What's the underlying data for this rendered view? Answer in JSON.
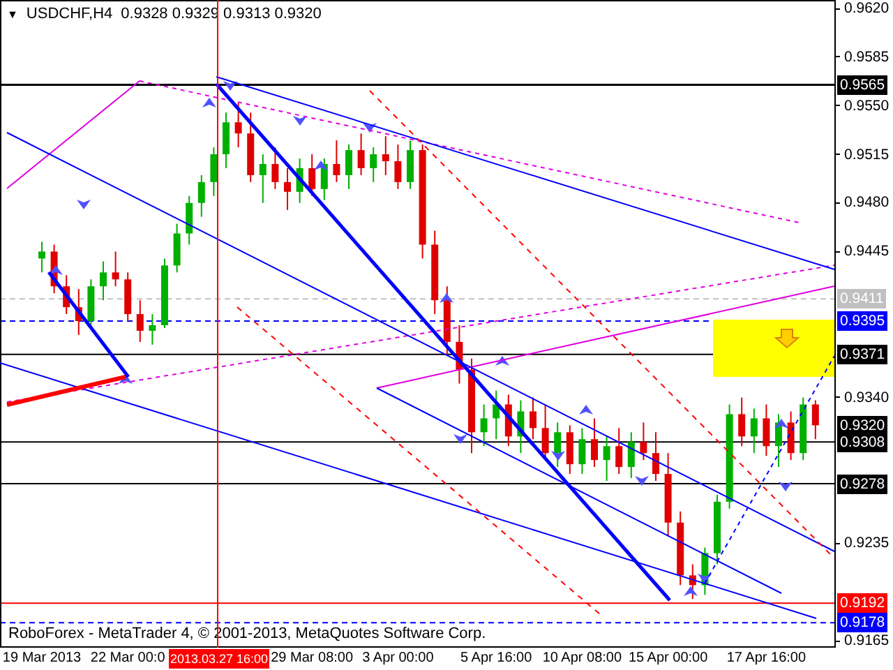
{
  "chart": {
    "symbol_menu": "▼",
    "title": "USDCHF,H4",
    "ohlc": "0.9328 0.9329 0.9313 0.9320",
    "copyright": "RoboForex - MetaTrader 4, © 2001-2013, MetaQuotes Software Corp.",
    "bid_marker": "0.9320",
    "crosshair_label": "2013.03.27 16:00",
    "chart_data": {
      "type": "candlestick",
      "categories": [
        "19 Mar 2013",
        null,
        null,
        null,
        null,
        null,
        null,
        "22 Mar 00:0",
        null,
        null,
        null,
        null,
        null,
        null,
        null,
        null,
        null,
        null,
        null,
        null,
        null,
        null,
        "29 Mar 08:00",
        null,
        null,
        null,
        null,
        null,
        null,
        "3 Apr 00:00",
        null,
        null,
        null,
        null,
        null,
        null,
        null,
        "5 Apr 16:00",
        null,
        null,
        null,
        null,
        null,
        null,
        "10 Apr 08:00",
        null,
        null,
        null,
        null,
        null,
        null,
        "15 Apr 00:00",
        null,
        null,
        null,
        null,
        null,
        null,
        null,
        "17 Apr 16:00",
        null,
        null,
        null,
        null
      ],
      "ohlc": [
        [
          0.944,
          0.9452,
          0.943,
          0.9445
        ],
        [
          0.9445,
          0.945,
          0.9415,
          0.942
        ],
        [
          0.942,
          0.9428,
          0.94,
          0.9405
        ],
        [
          0.9405,
          0.9418,
          0.9385,
          0.9395
        ],
        [
          0.9395,
          0.9425,
          0.939,
          0.942
        ],
        [
          0.942,
          0.9438,
          0.941,
          0.943
        ],
        [
          0.943,
          0.9445,
          0.942,
          0.9425
        ],
        [
          0.9425,
          0.943,
          0.9395,
          0.94
        ],
        [
          0.94,
          0.941,
          0.938,
          0.9388
        ],
        [
          0.9388,
          0.94,
          0.9378,
          0.9392
        ],
        [
          0.9392,
          0.944,
          0.939,
          0.9435
        ],
        [
          0.9435,
          0.9465,
          0.943,
          0.9458
        ],
        [
          0.9458,
          0.9485,
          0.945,
          0.948
        ],
        [
          0.948,
          0.95,
          0.947,
          0.9495
        ],
        [
          0.9495,
          0.952,
          0.9485,
          0.9515
        ],
        [
          0.9515,
          0.9545,
          0.9505,
          0.9538
        ],
        [
          0.9538,
          0.9552,
          0.952,
          0.953
        ],
        [
          0.953,
          0.9545,
          0.9495,
          0.95
        ],
        [
          0.95,
          0.9515,
          0.948,
          0.9508
        ],
        [
          0.9508,
          0.952,
          0.949,
          0.9495
        ],
        [
          0.9495,
          0.9505,
          0.9475,
          0.9488
        ],
        [
          0.9488,
          0.9512,
          0.948,
          0.9505
        ],
        [
          0.9505,
          0.9515,
          0.9485,
          0.949
        ],
        [
          0.949,
          0.9512,
          0.9482,
          0.9508
        ],
        [
          0.9508,
          0.9525,
          0.9495,
          0.95
        ],
        [
          0.95,
          0.9522,
          0.949,
          0.9518
        ],
        [
          0.9518,
          0.953,
          0.95,
          0.9505
        ],
        [
          0.9505,
          0.952,
          0.9495,
          0.9515
        ],
        [
          0.9515,
          0.9528,
          0.95,
          0.951
        ],
        [
          0.951,
          0.9522,
          0.949,
          0.9495
        ],
        [
          0.9495,
          0.9525,
          0.949,
          0.9518
        ],
        [
          0.9518,
          0.9522,
          0.944,
          0.945
        ],
        [
          0.945,
          0.946,
          0.94,
          0.941
        ],
        [
          0.941,
          0.942,
          0.937,
          0.938
        ],
        [
          0.938,
          0.9392,
          0.935,
          0.936
        ],
        [
          0.936,
          0.9368,
          0.93,
          0.9315
        ],
        [
          0.9315,
          0.9335,
          0.9305,
          0.9325
        ],
        [
          0.9325,
          0.9345,
          0.931,
          0.9335
        ],
        [
          0.9335,
          0.9342,
          0.9305,
          0.9312
        ],
        [
          0.9312,
          0.9338,
          0.93,
          0.933
        ],
        [
          0.933,
          0.934,
          0.931,
          0.9318
        ],
        [
          0.9318,
          0.9335,
          0.9295,
          0.93
        ],
        [
          0.93,
          0.9322,
          0.929,
          0.9315
        ],
        [
          0.9315,
          0.932,
          0.9285,
          0.9292
        ],
        [
          0.9292,
          0.9318,
          0.9285,
          0.931
        ],
        [
          0.931,
          0.9325,
          0.929,
          0.9295
        ],
        [
          0.9295,
          0.9312,
          0.928,
          0.9305
        ],
        [
          0.9305,
          0.9318,
          0.9285,
          0.929
        ],
        [
          0.929,
          0.9315,
          0.9282,
          0.9308
        ],
        [
          0.9308,
          0.9322,
          0.9295,
          0.93
        ],
        [
          0.93,
          0.9315,
          0.928,
          0.9285
        ],
        [
          0.9285,
          0.93,
          0.924,
          0.925
        ],
        [
          0.925,
          0.9258,
          0.9205,
          0.9212
        ],
        [
          0.9212,
          0.922,
          0.9195,
          0.9205
        ],
        [
          0.9205,
          0.9232,
          0.9198,
          0.9228
        ],
        [
          0.9228,
          0.927,
          0.922,
          0.9265
        ],
        [
          0.9265,
          0.9335,
          0.926,
          0.9328
        ],
        [
          0.9328,
          0.934,
          0.9305,
          0.9312
        ],
        [
          0.9312,
          0.9332,
          0.93,
          0.9325
        ],
        [
          0.9325,
          0.9335,
          0.9298,
          0.9305
        ],
        [
          0.9305,
          0.9328,
          0.929,
          0.9322
        ],
        [
          0.9322,
          0.933,
          0.9295,
          0.93
        ],
        [
          0.93,
          0.934,
          0.9295,
          0.9335
        ],
        [
          0.9335,
          0.9338,
          0.931,
          0.932
        ]
      ],
      "ylim": [
        0.916,
        0.9626
      ],
      "ref_lines": [
        {
          "axis": "y",
          "value": 0.9565,
          "label": "0.9565",
          "color": "#000000"
        },
        {
          "axis": "y",
          "value": 0.9411,
          "label": "0.9411",
          "color": "#c0c0c0"
        },
        {
          "axis": "y",
          "value": 0.9395,
          "label": "0.9395",
          "color": "#0000ff"
        },
        {
          "axis": "y",
          "value": 0.9371,
          "label": "0.9371",
          "color": "#000000"
        },
        {
          "axis": "y",
          "value": 0.9308,
          "label": "0.9308",
          "color": "#000000"
        },
        {
          "axis": "y",
          "value": 0.9278,
          "label": "0.9278",
          "color": "#000000"
        },
        {
          "axis": "y",
          "value": 0.9192,
          "label": "0.9192",
          "color": "#ff0000"
        },
        {
          "axis": "y",
          "value": 0.9178,
          "label": "0.9178",
          "color": "#0000ff"
        }
      ],
      "yticks": [
        {
          "value": 0.962,
          "label": "0.9620"
        },
        {
          "value": 0.9585,
          "label": "0.9585"
        },
        {
          "value": 0.955,
          "label": "0.9550"
        },
        {
          "value": 0.9515,
          "label": "0.9515"
        },
        {
          "value": 0.948,
          "label": "0.9480"
        },
        {
          "value": 0.9445,
          "label": "0.9445"
        },
        {
          "value": 0.934,
          "label": "0.9340"
        },
        {
          "value": 0.9235,
          "label": "0.9235"
        },
        {
          "value": 0.9165,
          "label": "0.9165"
        }
      ]
    }
  }
}
